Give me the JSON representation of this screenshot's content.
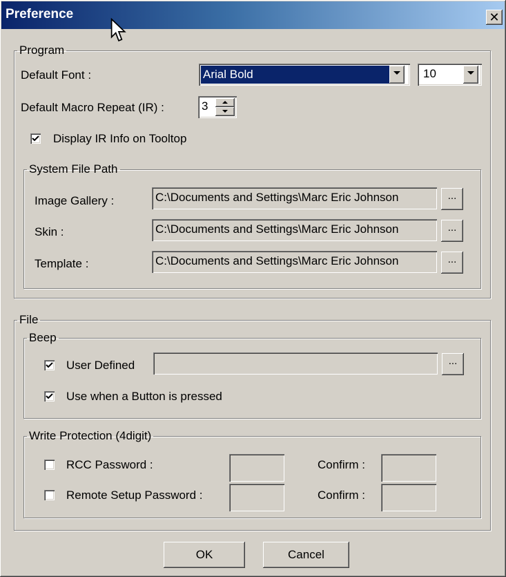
{
  "window": {
    "title": "Preference",
    "close_symbol": "✕"
  },
  "program": {
    "legend": "Program",
    "default_font_label": "Default Font :",
    "font_value": "Arial Bold",
    "size_value": "10",
    "macro_repeat_label": "Default Macro Repeat (IR) :",
    "macro_repeat_value": "3",
    "display_ir_label": "Display IR Info on Tooltop",
    "display_ir_checked": true,
    "system_file_path": {
      "legend": "System File Path",
      "browse_label": "...",
      "rows": [
        {
          "label": "Image Gallery :",
          "value": "C:\\Documents and Settings\\Marc Eric Johnson"
        },
        {
          "label": "Skin :",
          "value": "C:\\Documents and Settings\\Marc Eric Johnson"
        },
        {
          "label": "Template :",
          "value": "C:\\Documents and Settings\\Marc Eric Johnson"
        }
      ]
    }
  },
  "file": {
    "legend": "File",
    "beep": {
      "legend": "Beep",
      "user_defined_label": "User Defined",
      "user_defined_checked": true,
      "user_defined_value": "",
      "browse_label": "...",
      "use_button_label": "Use when a Button is pressed",
      "use_button_checked": true
    },
    "write_protection": {
      "legend": "Write Protection (4digit)",
      "rcc_label": "RCC Password :",
      "rcc_checked": false,
      "remote_label": "Remote Setup Password :",
      "remote_checked": false,
      "confirm_label": "Confirm :"
    }
  },
  "buttons": {
    "ok": "OK",
    "cancel": "Cancel"
  }
}
